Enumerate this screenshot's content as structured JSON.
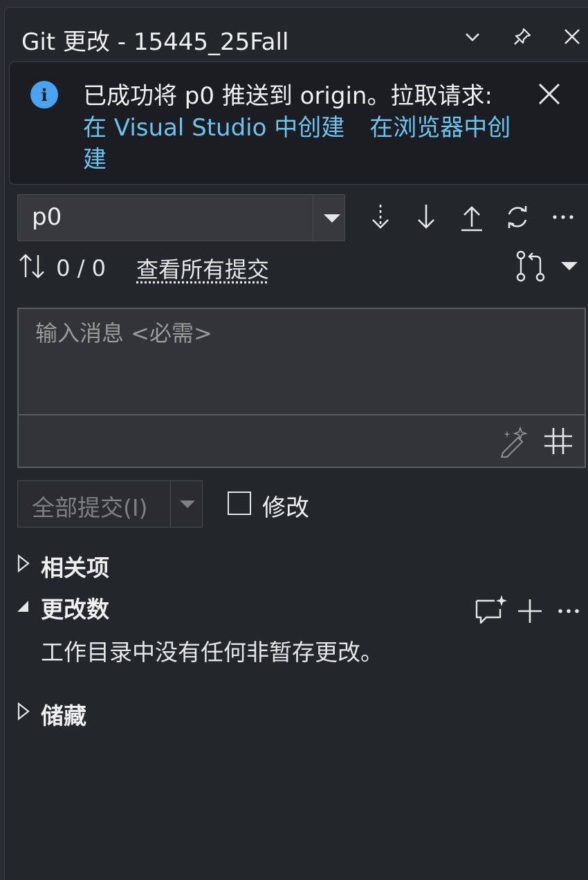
{
  "window": {
    "title": "Git 更改 - 15445_25Fall"
  },
  "titlebar": {
    "icons": [
      "chevron-down-icon",
      "pin-icon",
      "close-icon"
    ]
  },
  "notification": {
    "message": "已成功将 p0 推送到 origin。拉取请求:",
    "link_vs": "在 Visual Studio 中创建",
    "link_browser": "在浏览器中创建",
    "icon": "info-icon",
    "accent_color": "#4aa3f0"
  },
  "branch": {
    "current": "p0",
    "actions": [
      "fetch-icon",
      "pull-icon",
      "push-icon",
      "sync-icon",
      "more-icon"
    ]
  },
  "sync": {
    "count": "0 / 0",
    "view_all_commits": "查看所有提交"
  },
  "commit_message": {
    "placeholder": "输入消息 <必需>",
    "value": ""
  },
  "commit": {
    "commit_all_label": "全部提交(I)",
    "amend_label": "修改",
    "amend_checked": false
  },
  "sections": {
    "related": "相关项",
    "changes": "更改数",
    "changes_empty": "工作目录中没有任何非暂存更改。",
    "stashes": "储藏"
  }
}
